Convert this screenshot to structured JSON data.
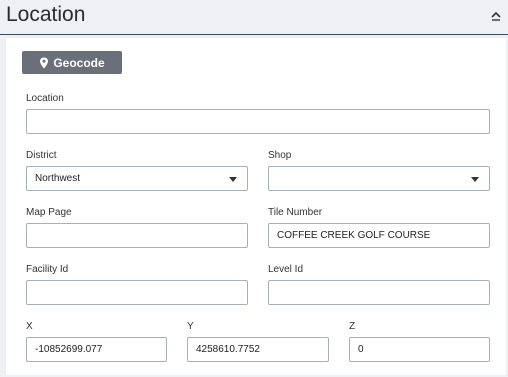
{
  "header": {
    "title": "Location",
    "collapse_icon": "chevron-up-icon"
  },
  "geocode_button": {
    "label": "Geocode",
    "icon": "map-pin-icon"
  },
  "fields": {
    "location": {
      "label": "Location",
      "value": ""
    },
    "district": {
      "label": "District",
      "value": "Northwest"
    },
    "shop": {
      "label": "Shop",
      "value": ""
    },
    "map_page": {
      "label": "Map Page",
      "value": ""
    },
    "tile_number": {
      "label": "Tile Number",
      "value": "COFFEE CREEK GOLF COURSE"
    },
    "facility_id": {
      "label": "Facility Id",
      "value": ""
    },
    "level_id": {
      "label": "Level Id",
      "value": ""
    },
    "x": {
      "label": "X",
      "value": "-10852699.077"
    },
    "y": {
      "label": "Y",
      "value": "4258610.7752"
    },
    "z": {
      "label": "Z",
      "value": "0"
    }
  },
  "colors": {
    "button_bg": "#6b6f79",
    "header_rule": "#3d4a5c",
    "page_bg": "#eef0f3"
  }
}
